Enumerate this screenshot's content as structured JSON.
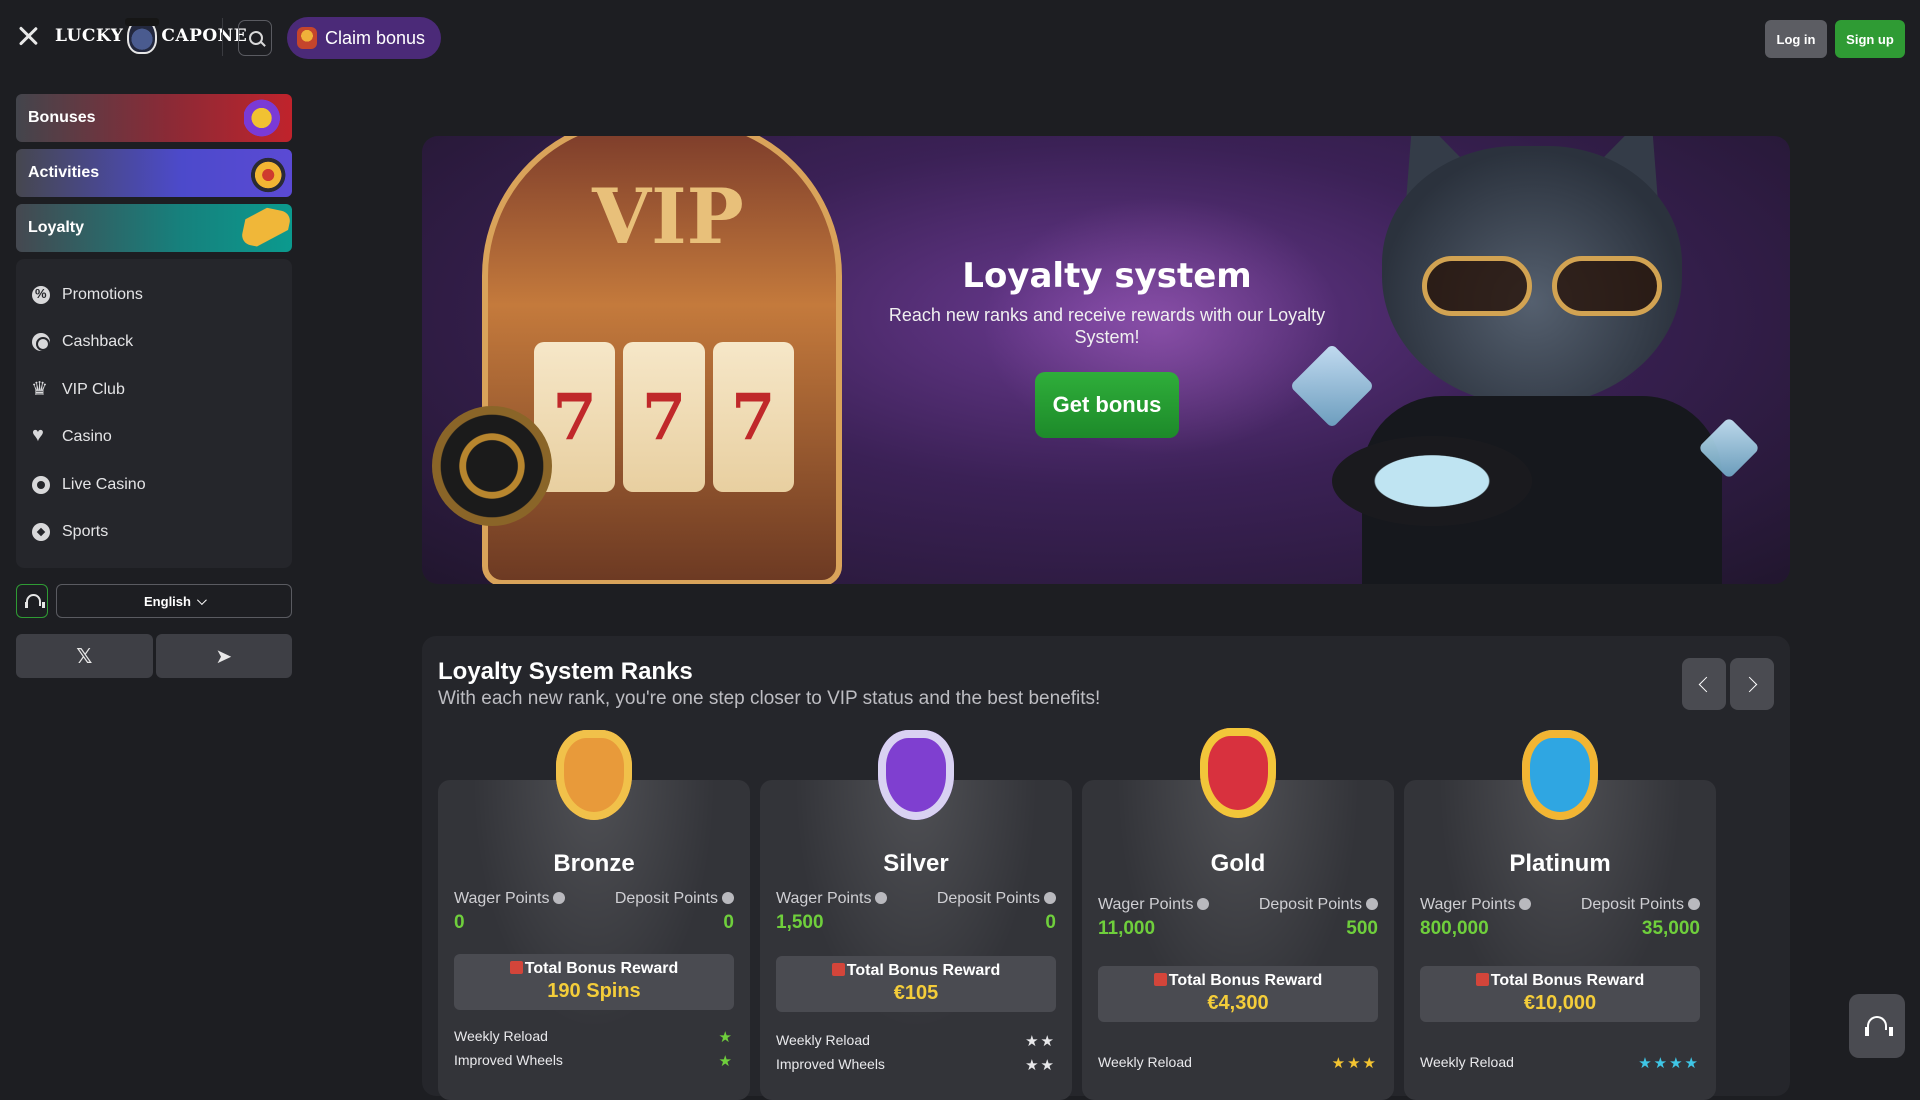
{
  "header": {
    "logo_text_left": "LUCKY",
    "logo_text_right": "CAPONE",
    "claim_bonus_label": "Claim bonus",
    "login_label": "Log in",
    "signup_label": "Sign up"
  },
  "sidebar": {
    "featured": [
      {
        "label": "Bonuses"
      },
      {
        "label": "Activities"
      },
      {
        "label": "Loyalty"
      }
    ],
    "nav": [
      {
        "label": "Promotions",
        "icon": "percent-badge-icon"
      },
      {
        "label": "Cashback",
        "icon": "cashback-icon"
      },
      {
        "label": "VIP Club",
        "icon": "crown-icon"
      },
      {
        "label": "Casino",
        "icon": "card-suit-icon"
      },
      {
        "label": "Live Casino",
        "icon": "live-casino-icon"
      },
      {
        "label": "Sports",
        "icon": "soccer-ball-icon"
      }
    ],
    "language": "English",
    "social": {
      "x_label": "𝕏",
      "telegram_label": "➤"
    }
  },
  "hero": {
    "title": "Loyalty system",
    "subtitle": "Reach new ranks and receive rewards with our Loyalty System!",
    "cta_label": "Get bonus",
    "slot_text": "VIP",
    "reels": [
      "7",
      "7",
      "7"
    ]
  },
  "ranks": {
    "title": "Loyalty System Ranks",
    "subtitle": "With each new rank, you're one step closer to VIP status and the best benefits!",
    "wager_label": "Wager Points",
    "deposit_label": "Deposit Points",
    "reward_label": "Total Bonus Reward",
    "cards": [
      {
        "name": "Bronze",
        "wager": "0",
        "deposit": "0",
        "reward": "190 Spins",
        "perks": [
          {
            "label": "Weekly Reload",
            "stars": "★"
          },
          {
            "label": "Improved Wheels",
            "stars": "★"
          }
        ],
        "star_color": "#6fcf3c",
        "badge_color": "#1fa05a"
      },
      {
        "name": "Silver",
        "wager": "1,500",
        "deposit": "0",
        "reward": "€105",
        "perks": [
          {
            "label": "Weekly Reload",
            "stars": "★★"
          },
          {
            "label": "Improved Wheels",
            "stars": "★★"
          }
        ],
        "star_color": "#e8e8ea",
        "badge_color": "#6a4fd0"
      },
      {
        "name": "Gold",
        "wager": "11,000",
        "deposit": "500",
        "reward": "€4,300",
        "perks": [
          {
            "label": "Weekly Reload",
            "stars": "★★★"
          }
        ],
        "star_color": "#f4c431",
        "badge_color": "#d8313e"
      },
      {
        "name": "Platinum",
        "wager": "800,000",
        "deposit": "35,000",
        "reward": "€10,000",
        "perks": [
          {
            "label": "Weekly Reload",
            "stars": "★★★★"
          }
        ],
        "star_color": "#3fc6e6",
        "badge_color": "#2fa6e2"
      }
    ]
  }
}
